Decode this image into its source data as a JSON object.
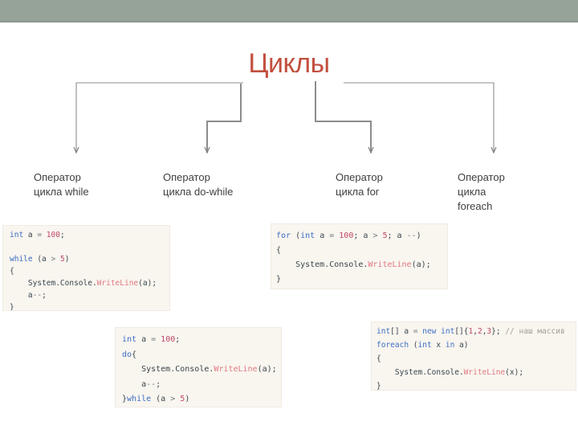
{
  "slide": {
    "title": "Циклы",
    "title_color": "#C2503F",
    "top_bar_color": "#95A399",
    "connector_color": "#808080"
  },
  "branches": [
    {
      "label": "Оператор\nцикла while"
    },
    {
      "label": "Оператор\nцикла do-while"
    },
    {
      "label": "Оператор\nцикла for"
    },
    {
      "label": "Оператор\nцикла\nforeach"
    }
  ],
  "code_snippets": {
    "while": [
      [
        {
          "c": "kw",
          "t": "int"
        },
        {
          "c": "txt",
          "t": " a "
        },
        {
          "c": "op",
          "t": "= "
        },
        {
          "c": "num",
          "t": "100"
        },
        {
          "c": "txt",
          "t": ";"
        }
      ],
      [
        {
          "c": "txt",
          "t": " "
        }
      ],
      [
        {
          "c": "kw",
          "t": "while"
        },
        {
          "c": "txt",
          "t": " (a "
        },
        {
          "c": "op",
          "t": "> "
        },
        {
          "c": "num",
          "t": "5"
        },
        {
          "c": "txt",
          "t": ")"
        }
      ],
      [
        {
          "c": "txt",
          "t": "{"
        }
      ],
      [
        {
          "c": "txt",
          "t": "    System.Console."
        },
        {
          "c": "fn",
          "t": "WriteLine"
        },
        {
          "c": "txt",
          "t": "(a);"
        }
      ],
      [
        {
          "c": "txt",
          "t": "    a"
        },
        {
          "c": "op",
          "t": "--"
        },
        {
          "c": "txt",
          "t": ";"
        }
      ],
      [
        {
          "c": "txt",
          "t": "}"
        }
      ]
    ],
    "dowhile": [
      [
        {
          "c": "kw",
          "t": "int"
        },
        {
          "c": "txt",
          "t": " a "
        },
        {
          "c": "op",
          "t": "= "
        },
        {
          "c": "num",
          "t": "100"
        },
        {
          "c": "txt",
          "t": ";"
        }
      ],
      [
        {
          "c": "kw",
          "t": "do"
        },
        {
          "c": "txt",
          "t": "{"
        }
      ],
      [
        {
          "c": "txt",
          "t": "    System.Console."
        },
        {
          "c": "fn",
          "t": "WriteLine"
        },
        {
          "c": "txt",
          "t": "(a);"
        }
      ],
      [
        {
          "c": "txt",
          "t": "    a"
        },
        {
          "c": "op",
          "t": "--"
        },
        {
          "c": "txt",
          "t": ";"
        }
      ],
      [
        {
          "c": "txt",
          "t": "}"
        },
        {
          "c": "kw",
          "t": "while"
        },
        {
          "c": "txt",
          "t": " (a "
        },
        {
          "c": "op",
          "t": "> "
        },
        {
          "c": "num",
          "t": "5"
        },
        {
          "c": "txt",
          "t": ")"
        }
      ]
    ],
    "for": [
      [
        {
          "c": "kw",
          "t": "for"
        },
        {
          "c": "txt",
          "t": " ("
        },
        {
          "c": "kw",
          "t": "int"
        },
        {
          "c": "txt",
          "t": " a "
        },
        {
          "c": "op",
          "t": "= "
        },
        {
          "c": "num",
          "t": "100"
        },
        {
          "c": "txt",
          "t": "; a "
        },
        {
          "c": "op",
          "t": "> "
        },
        {
          "c": "num",
          "t": "5"
        },
        {
          "c": "txt",
          "t": "; a "
        },
        {
          "c": "op",
          "t": "--"
        },
        {
          "c": "txt",
          "t": ")"
        }
      ],
      [
        {
          "c": "txt",
          "t": "{"
        }
      ],
      [
        {
          "c": "txt",
          "t": "    System.Console."
        },
        {
          "c": "fn",
          "t": "WriteLine"
        },
        {
          "c": "txt",
          "t": "(a);"
        }
      ],
      [
        {
          "c": "txt",
          "t": "}"
        }
      ]
    ],
    "foreach": [
      [
        {
          "c": "kw",
          "t": "int"
        },
        {
          "c": "txt",
          "t": "[] a "
        },
        {
          "c": "op",
          "t": "= "
        },
        {
          "c": "kw",
          "t": "new"
        },
        {
          "c": "txt",
          "t": " "
        },
        {
          "c": "kw",
          "t": "int"
        },
        {
          "c": "txt",
          "t": "[]{"
        },
        {
          "c": "num",
          "t": "1"
        },
        {
          "c": "txt",
          "t": ","
        },
        {
          "c": "num",
          "t": "2"
        },
        {
          "c": "txt",
          "t": ","
        },
        {
          "c": "num",
          "t": "3"
        },
        {
          "c": "txt",
          "t": "}; "
        },
        {
          "c": "cm",
          "t": "// наш массив"
        }
      ],
      [
        {
          "c": "kw",
          "t": "foreach"
        },
        {
          "c": "txt",
          "t": " ("
        },
        {
          "c": "kw",
          "t": "int"
        },
        {
          "c": "txt",
          "t": " x "
        },
        {
          "c": "kw",
          "t": "in"
        },
        {
          "c": "txt",
          "t": " a)"
        }
      ],
      [
        {
          "c": "txt",
          "t": "{"
        }
      ],
      [
        {
          "c": "txt",
          "t": "    System.Console."
        },
        {
          "c": "fn",
          "t": "WriteLine"
        },
        {
          "c": "txt",
          "t": "(x);"
        }
      ],
      [
        {
          "c": "txt",
          "t": "}"
        }
      ]
    ]
  }
}
